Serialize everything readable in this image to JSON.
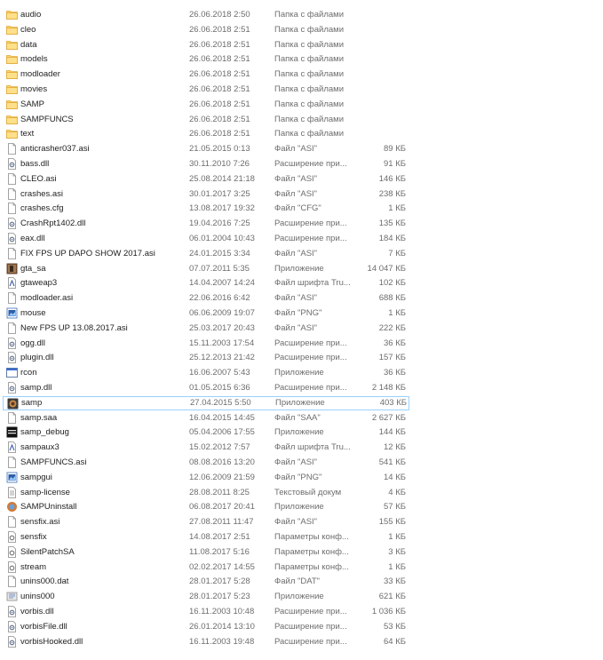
{
  "files": [
    {
      "name": "audio",
      "date": "26.06.2018 2:50",
      "type": "Папка с файлами",
      "size": "",
      "icon": "folder"
    },
    {
      "name": "cleo",
      "date": "26.06.2018 2:51",
      "type": "Папка с файлами",
      "size": "",
      "icon": "folder"
    },
    {
      "name": "data",
      "date": "26.06.2018 2:51",
      "type": "Папка с файлами",
      "size": "",
      "icon": "folder"
    },
    {
      "name": "models",
      "date": "26.06.2018 2:51",
      "type": "Папка с файлами",
      "size": "",
      "icon": "folder"
    },
    {
      "name": "modloader",
      "date": "26.06.2018 2:51",
      "type": "Папка с файлами",
      "size": "",
      "icon": "folder"
    },
    {
      "name": "movies",
      "date": "26.06.2018 2:51",
      "type": "Папка с файлами",
      "size": "",
      "icon": "folder"
    },
    {
      "name": "SAMP",
      "date": "26.06.2018 2:51",
      "type": "Папка с файлами",
      "size": "",
      "icon": "folder"
    },
    {
      "name": "SAMPFUNCS",
      "date": "26.06.2018 2:51",
      "type": "Папка с файлами",
      "size": "",
      "icon": "folder"
    },
    {
      "name": "text",
      "date": "26.06.2018 2:51",
      "type": "Папка с файлами",
      "size": "",
      "icon": "folder"
    },
    {
      "name": "anticrasher037.asi",
      "date": "21.05.2015 0:13",
      "type": "Файл \"ASI\"",
      "size": "89 КБ",
      "icon": "file"
    },
    {
      "name": "bass.dll",
      "date": "30.11.2010 7:26",
      "type": "Расширение при...",
      "size": "91 КБ",
      "icon": "dll"
    },
    {
      "name": "CLEO.asi",
      "date": "25.08.2014 21:18",
      "type": "Файл \"ASI\"",
      "size": "146 КБ",
      "icon": "file"
    },
    {
      "name": "crashes.asi",
      "date": "30.01.2017 3:25",
      "type": "Файл \"ASI\"",
      "size": "238 КБ",
      "icon": "file"
    },
    {
      "name": "crashes.cfg",
      "date": "13.08.2017 19:32",
      "type": "Файл \"CFG\"",
      "size": "1 КБ",
      "icon": "file"
    },
    {
      "name": "CrashRpt1402.dll",
      "date": "19.04.2016 7:25",
      "type": "Расширение при...",
      "size": "135 КБ",
      "icon": "dll"
    },
    {
      "name": "eax.dll",
      "date": "06.01.2004 10:43",
      "type": "Расширение при...",
      "size": "184 КБ",
      "icon": "dll"
    },
    {
      "name": "FIX FPS UP DAPO SHOW 2017.asi",
      "date": "24.01.2015 3:34",
      "type": "Файл \"ASI\"",
      "size": "7 КБ",
      "icon": "file"
    },
    {
      "name": "gta_sa",
      "date": "07.07.2011 5:35",
      "type": "Приложение",
      "size": "14 047 КБ",
      "icon": "gta"
    },
    {
      "name": "gtaweap3",
      "date": "14.04.2007 14:24",
      "type": "Файл шрифта Tru...",
      "size": "102 КБ",
      "icon": "font"
    },
    {
      "name": "modloader.asi",
      "date": "22.06.2016 6:42",
      "type": "Файл \"ASI\"",
      "size": "688 КБ",
      "icon": "file"
    },
    {
      "name": "mouse",
      "date": "06.06.2009 19:07",
      "type": "Файл \"PNG\"",
      "size": "1 КБ",
      "icon": "png"
    },
    {
      "name": "New FPS UP 13.08.2017.asi",
      "date": "25.03.2017 20:43",
      "type": "Файл \"ASI\"",
      "size": "222 КБ",
      "icon": "file"
    },
    {
      "name": "ogg.dll",
      "date": "15.11.2003 17:54",
      "type": "Расширение при...",
      "size": "36 КБ",
      "icon": "dll"
    },
    {
      "name": "plugin.dll",
      "date": "25.12.2013 21:42",
      "type": "Расширение при...",
      "size": "157 КБ",
      "icon": "dll"
    },
    {
      "name": "rcon",
      "date": "16.06.2007 5:43",
      "type": "Приложение",
      "size": "36 КБ",
      "icon": "exe"
    },
    {
      "name": "samp.dll",
      "date": "01.05.2015 6:36",
      "type": "Расширение при...",
      "size": "2 148 КБ",
      "icon": "dll"
    },
    {
      "name": "samp",
      "date": "27.04.2015 5:50",
      "type": "Приложение",
      "size": "403 КБ",
      "icon": "samp",
      "selected": true
    },
    {
      "name": "samp.saa",
      "date": "16.04.2015 14:45",
      "type": "Файл \"SAA\"",
      "size": "2 627 КБ",
      "icon": "file"
    },
    {
      "name": "samp_debug",
      "date": "05.04.2006 17:55",
      "type": "Приложение",
      "size": "144 КБ",
      "icon": "sampdebug"
    },
    {
      "name": "sampaux3",
      "date": "15.02.2012 7:57",
      "type": "Файл шрифта Tru...",
      "size": "12 КБ",
      "icon": "font"
    },
    {
      "name": "SAMPFUNCS.asi",
      "date": "08.08.2016 13:20",
      "type": "Файл \"ASI\"",
      "size": "541 КБ",
      "icon": "file"
    },
    {
      "name": "sampgui",
      "date": "12.06.2009 21:59",
      "type": "Файл \"PNG\"",
      "size": "14 КБ",
      "icon": "png"
    },
    {
      "name": "samp-license",
      "date": "28.08.2011 8:25",
      "type": "Текстовый докум",
      "size": "4 КБ",
      "icon": "txt"
    },
    {
      "name": "SAMPUninstall",
      "date": "06.08.2017 20:41",
      "type": "Приложение",
      "size": "57 КБ",
      "icon": "uninstall"
    },
    {
      "name": "sensfix.asi",
      "date": "27.08.2011 11:47",
      "type": "Файл \"ASI\"",
      "size": "155 КБ",
      "icon": "file"
    },
    {
      "name": "sensfix",
      "date": "14.08.2017 2:51",
      "type": "Параметры конф...",
      "size": "1 КБ",
      "icon": "cfg"
    },
    {
      "name": "SilentPatchSA",
      "date": "11.08.2017 5:16",
      "type": "Параметры конф...",
      "size": "3 КБ",
      "icon": "cfg"
    },
    {
      "name": "stream",
      "date": "02.02.2017 14:55",
      "type": "Параметры конф...",
      "size": "1 КБ",
      "icon": "cfg"
    },
    {
      "name": "unins000.dat",
      "date": "28.01.2017 5:28",
      "type": "Файл \"DAT\"",
      "size": "33 КБ",
      "icon": "file"
    },
    {
      "name": "unins000",
      "date": "28.01.2017 5:23",
      "type": "Приложение",
      "size": "621 КБ",
      "icon": "uninstall2"
    },
    {
      "name": "vorbis.dll",
      "date": "16.11.2003 10:48",
      "type": "Расширение при...",
      "size": "1 036 КБ",
      "icon": "dll"
    },
    {
      "name": "vorbisFile.dll",
      "date": "26.01.2014 13:10",
      "type": "Расширение при...",
      "size": "53 КБ",
      "icon": "dll"
    },
    {
      "name": "vorbisHooked.dll",
      "date": "16.11.2003 19:48",
      "type": "Расширение при...",
      "size": "64 КБ",
      "icon": "dll"
    }
  ]
}
